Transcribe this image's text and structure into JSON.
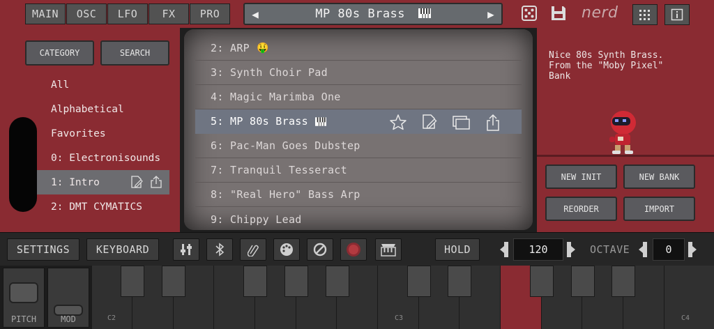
{
  "tabs": [
    "MAIN",
    "OSC",
    "LFO",
    "FX",
    "PRO"
  ],
  "preset_bar": {
    "prev": "◀",
    "name": "MP 80s Brass",
    "next": "▶"
  },
  "top_icons": [
    "dice-icon",
    "save-icon"
  ],
  "logo": "nerd",
  "left_panel": {
    "category_label": "CATEGORY",
    "search_label": "SEARCH",
    "items": [
      {
        "label": "All"
      },
      {
        "label": "Alphabetical"
      },
      {
        "label": "Favorites"
      },
      {
        "label": "0: Electronisounds"
      },
      {
        "label": "1: Intro",
        "selected": true
      },
      {
        "label": "2: DMT CYMATICS"
      }
    ]
  },
  "presets": [
    {
      "label": "2: ARP",
      "emoji": "🤑"
    },
    {
      "label": "3: Synth Choir Pad"
    },
    {
      "label": "4: Magic Marimba One"
    },
    {
      "label": "5: MP 80s Brass",
      "selected": true
    },
    {
      "label": "6: Pac-Man Goes Dubstep"
    },
    {
      "label": "7: Tranquil Tesseract"
    },
    {
      "label": "8: \"Real Hero\" Bass Arp"
    },
    {
      "label": "9: Chippy Lead"
    }
  ],
  "right_panel": {
    "description": "Nice 80s Synth Brass.\nFrom the \"Moby Pixel\"\nBank",
    "new_init": "NEW INIT",
    "new_bank": "NEW BANK",
    "reorder": "REORDER",
    "import": "IMPORT"
  },
  "controls": {
    "settings": "SETTINGS",
    "keyboard": "KEYBOARD",
    "hold": "HOLD",
    "tempo": "120",
    "octave_label": "OCTAVE",
    "octave": "0"
  },
  "keyboard": {
    "pitch_label": "PITCH",
    "mod_label": "MOD",
    "c_labels": [
      "C2",
      "C3",
      "C4"
    ]
  },
  "colors": {
    "accent": "#8a2b32",
    "selected_row": "#6f7582",
    "panel": "#2a2a2a"
  }
}
